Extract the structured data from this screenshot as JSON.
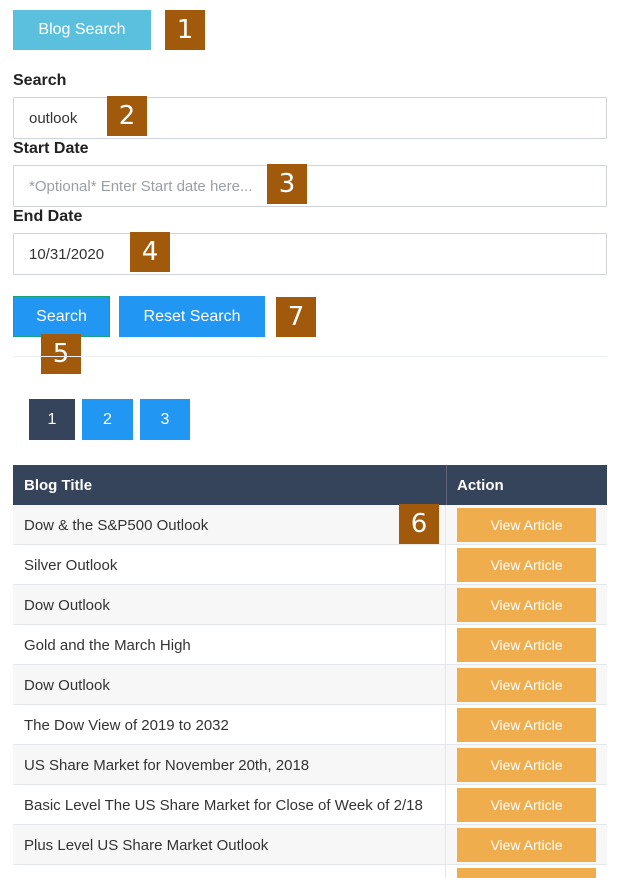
{
  "header": {
    "blog_search_label": "Blog Search"
  },
  "markers": [
    "1",
    "2",
    "3",
    "4",
    "5",
    "6",
    "7"
  ],
  "form": {
    "search_label": "Search",
    "search_value": "outlook",
    "start_label": "Start Date",
    "start_placeholder": "*Optional* Enter Start date here...",
    "end_label": "End Date",
    "end_value": "10/31/2020",
    "search_button": "Search",
    "reset_button": "Reset Search"
  },
  "pagination": {
    "pages": [
      "1",
      "2",
      "3"
    ],
    "current": "1"
  },
  "table": {
    "headers": [
      "Blog Title",
      "Action"
    ],
    "action_label": "View Article",
    "rows": [
      "Dow & the S&P500 Outlook",
      "Silver Outlook",
      "Dow Outlook",
      "Gold and the March High",
      "Dow Outlook",
      "The Dow View of 2019 to 2032",
      "US Share Market for November 20th, 2018",
      "Basic Level The US Share Market for Close of Week of 2/18",
      "Plus Level US Share Market Outlook"
    ]
  },
  "colors": {
    "blog_button": "#5bc0de",
    "primary": "#2196f3",
    "header_dark": "#36445b",
    "view_button": "#f0ad4e",
    "marker": "#a15a0b"
  }
}
